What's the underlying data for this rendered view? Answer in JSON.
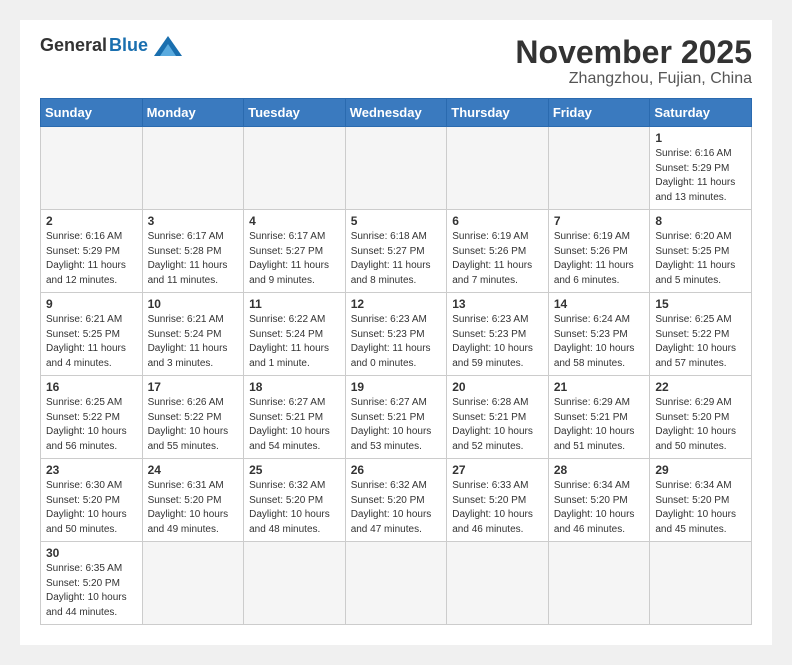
{
  "logo": {
    "general": "General",
    "blue": "Blue"
  },
  "header": {
    "month": "November 2025",
    "location": "Zhangzhou, Fujian, China"
  },
  "weekdays": [
    "Sunday",
    "Monday",
    "Tuesday",
    "Wednesday",
    "Thursday",
    "Friday",
    "Saturday"
  ],
  "days": [
    {
      "date": "",
      "sunrise": "",
      "sunset": "",
      "daylight": ""
    },
    {
      "date": "",
      "sunrise": "",
      "sunset": "",
      "daylight": ""
    },
    {
      "date": "",
      "sunrise": "",
      "sunset": "",
      "daylight": ""
    },
    {
      "date": "",
      "sunrise": "",
      "sunset": "",
      "daylight": ""
    },
    {
      "date": "",
      "sunrise": "",
      "sunset": "",
      "daylight": ""
    },
    {
      "date": "",
      "sunrise": "",
      "sunset": "",
      "daylight": ""
    },
    {
      "date": "1",
      "sunrise": "Sunrise: 6:16 AM",
      "sunset": "Sunset: 5:29 PM",
      "daylight": "Daylight: 11 hours and 13 minutes."
    },
    {
      "date": "2",
      "sunrise": "Sunrise: 6:16 AM",
      "sunset": "Sunset: 5:29 PM",
      "daylight": "Daylight: 11 hours and 12 minutes."
    },
    {
      "date": "3",
      "sunrise": "Sunrise: 6:17 AM",
      "sunset": "Sunset: 5:28 PM",
      "daylight": "Daylight: 11 hours and 11 minutes."
    },
    {
      "date": "4",
      "sunrise": "Sunrise: 6:17 AM",
      "sunset": "Sunset: 5:27 PM",
      "daylight": "Daylight: 11 hours and 9 minutes."
    },
    {
      "date": "5",
      "sunrise": "Sunrise: 6:18 AM",
      "sunset": "Sunset: 5:27 PM",
      "daylight": "Daylight: 11 hours and 8 minutes."
    },
    {
      "date": "6",
      "sunrise": "Sunrise: 6:19 AM",
      "sunset": "Sunset: 5:26 PM",
      "daylight": "Daylight: 11 hours and 7 minutes."
    },
    {
      "date": "7",
      "sunrise": "Sunrise: 6:19 AM",
      "sunset": "Sunset: 5:26 PM",
      "daylight": "Daylight: 11 hours and 6 minutes."
    },
    {
      "date": "8",
      "sunrise": "Sunrise: 6:20 AM",
      "sunset": "Sunset: 5:25 PM",
      "daylight": "Daylight: 11 hours and 5 minutes."
    },
    {
      "date": "9",
      "sunrise": "Sunrise: 6:21 AM",
      "sunset": "Sunset: 5:25 PM",
      "daylight": "Daylight: 11 hours and 4 minutes."
    },
    {
      "date": "10",
      "sunrise": "Sunrise: 6:21 AM",
      "sunset": "Sunset: 5:24 PM",
      "daylight": "Daylight: 11 hours and 3 minutes."
    },
    {
      "date": "11",
      "sunrise": "Sunrise: 6:22 AM",
      "sunset": "Sunset: 5:24 PM",
      "daylight": "Daylight: 11 hours and 1 minute."
    },
    {
      "date": "12",
      "sunrise": "Sunrise: 6:23 AM",
      "sunset": "Sunset: 5:23 PM",
      "daylight": "Daylight: 11 hours and 0 minutes."
    },
    {
      "date": "13",
      "sunrise": "Sunrise: 6:23 AM",
      "sunset": "Sunset: 5:23 PM",
      "daylight": "Daylight: 10 hours and 59 minutes."
    },
    {
      "date": "14",
      "sunrise": "Sunrise: 6:24 AM",
      "sunset": "Sunset: 5:23 PM",
      "daylight": "Daylight: 10 hours and 58 minutes."
    },
    {
      "date": "15",
      "sunrise": "Sunrise: 6:25 AM",
      "sunset": "Sunset: 5:22 PM",
      "daylight": "Daylight: 10 hours and 57 minutes."
    },
    {
      "date": "16",
      "sunrise": "Sunrise: 6:25 AM",
      "sunset": "Sunset: 5:22 PM",
      "daylight": "Daylight: 10 hours and 56 minutes."
    },
    {
      "date": "17",
      "sunrise": "Sunrise: 6:26 AM",
      "sunset": "Sunset: 5:22 PM",
      "daylight": "Daylight: 10 hours and 55 minutes."
    },
    {
      "date": "18",
      "sunrise": "Sunrise: 6:27 AM",
      "sunset": "Sunset: 5:21 PM",
      "daylight": "Daylight: 10 hours and 54 minutes."
    },
    {
      "date": "19",
      "sunrise": "Sunrise: 6:27 AM",
      "sunset": "Sunset: 5:21 PM",
      "daylight": "Daylight: 10 hours and 53 minutes."
    },
    {
      "date": "20",
      "sunrise": "Sunrise: 6:28 AM",
      "sunset": "Sunset: 5:21 PM",
      "daylight": "Daylight: 10 hours and 52 minutes."
    },
    {
      "date": "21",
      "sunrise": "Sunrise: 6:29 AM",
      "sunset": "Sunset: 5:21 PM",
      "daylight": "Daylight: 10 hours and 51 minutes."
    },
    {
      "date": "22",
      "sunrise": "Sunrise: 6:29 AM",
      "sunset": "Sunset: 5:20 PM",
      "daylight": "Daylight: 10 hours and 50 minutes."
    },
    {
      "date": "23",
      "sunrise": "Sunrise: 6:30 AM",
      "sunset": "Sunset: 5:20 PM",
      "daylight": "Daylight: 10 hours and 50 minutes."
    },
    {
      "date": "24",
      "sunrise": "Sunrise: 6:31 AM",
      "sunset": "Sunset: 5:20 PM",
      "daylight": "Daylight: 10 hours and 49 minutes."
    },
    {
      "date": "25",
      "sunrise": "Sunrise: 6:32 AM",
      "sunset": "Sunset: 5:20 PM",
      "daylight": "Daylight: 10 hours and 48 minutes."
    },
    {
      "date": "26",
      "sunrise": "Sunrise: 6:32 AM",
      "sunset": "Sunset: 5:20 PM",
      "daylight": "Daylight: 10 hours and 47 minutes."
    },
    {
      "date": "27",
      "sunrise": "Sunrise: 6:33 AM",
      "sunset": "Sunset: 5:20 PM",
      "daylight": "Daylight: 10 hours and 46 minutes."
    },
    {
      "date": "28",
      "sunrise": "Sunrise: 6:34 AM",
      "sunset": "Sunset: 5:20 PM",
      "daylight": "Daylight: 10 hours and 46 minutes."
    },
    {
      "date": "29",
      "sunrise": "Sunrise: 6:34 AM",
      "sunset": "Sunset: 5:20 PM",
      "daylight": "Daylight: 10 hours and 45 minutes."
    },
    {
      "date": "30",
      "sunrise": "Sunrise: 6:35 AM",
      "sunset": "Sunset: 5:20 PM",
      "daylight": "Daylight: 10 hours and 44 minutes."
    }
  ]
}
